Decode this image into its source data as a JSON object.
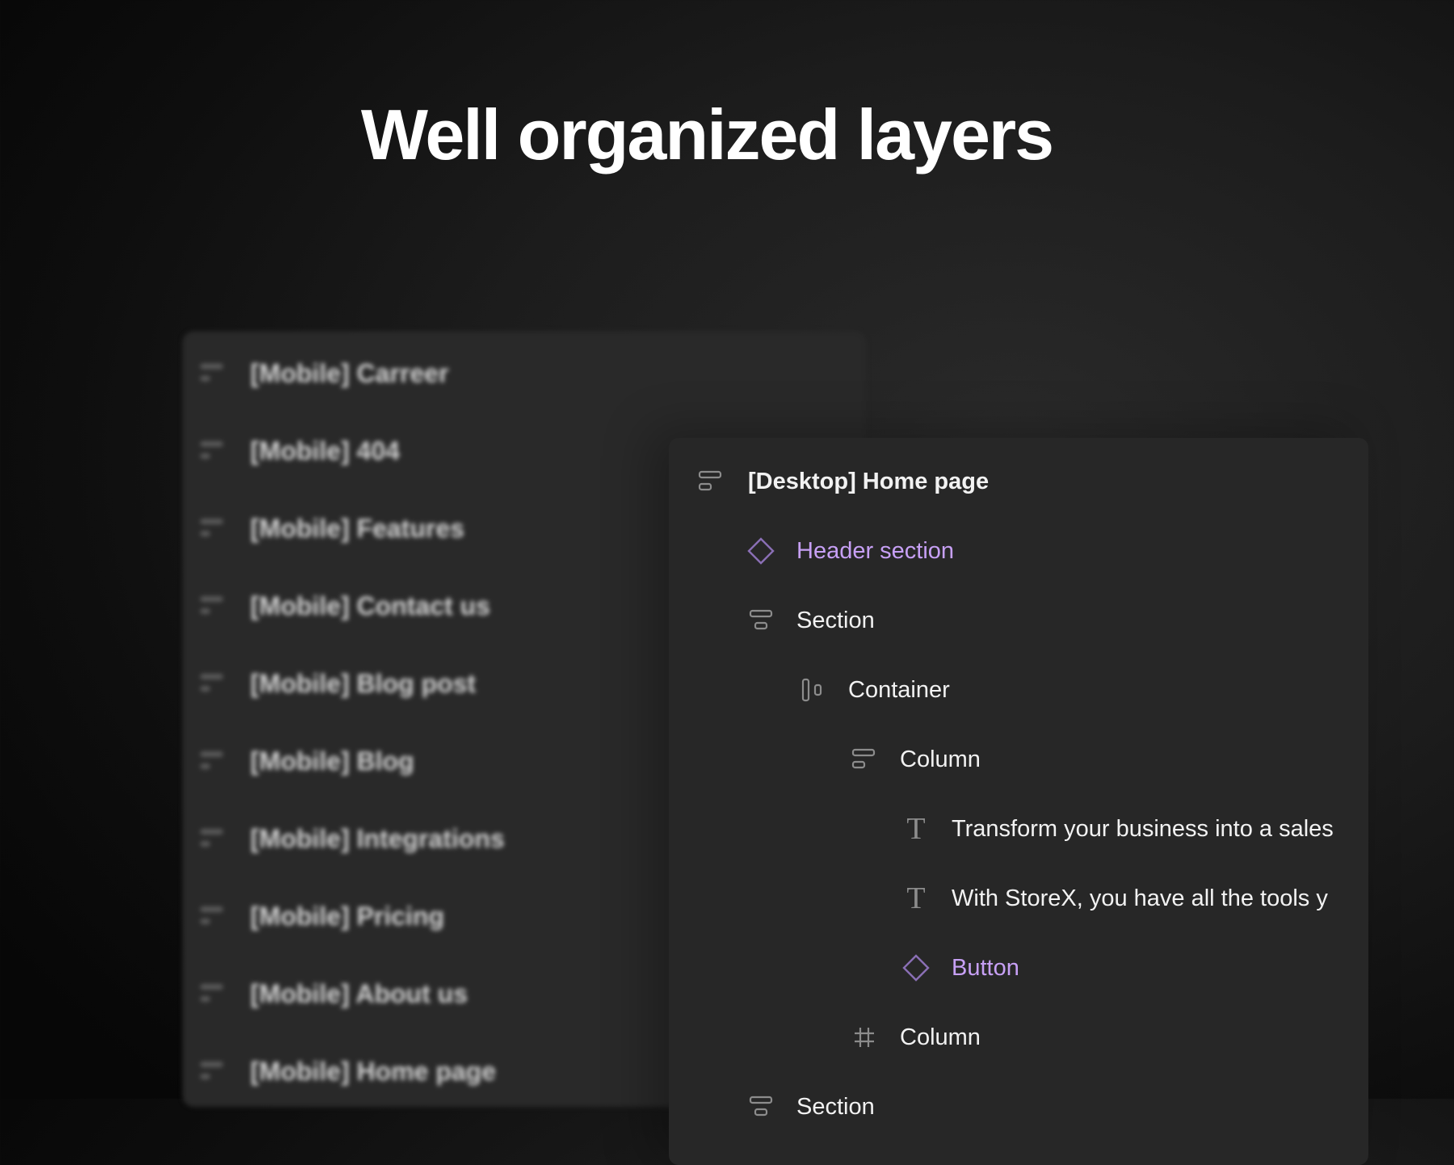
{
  "headline": "Well organized layers",
  "colors": {
    "component": "#c7a0f5",
    "text": "#f2f2f2",
    "icon": "#8c8c8c",
    "panel": "#272727"
  },
  "back_panel": {
    "items": [
      {
        "label": "[Mobile] Carreer",
        "icon": "frame-stack-icon"
      },
      {
        "label": "[Mobile] 404",
        "icon": "frame-stack-icon"
      },
      {
        "label": "[Mobile] Features",
        "icon": "frame-stack-icon"
      },
      {
        "label": "[Mobile] Contact us",
        "icon": "frame-stack-icon"
      },
      {
        "label": "[Mobile] Blog post",
        "icon": "frame-stack-icon"
      },
      {
        "label": "[Mobile] Blog",
        "icon": "frame-stack-icon"
      },
      {
        "label": "[Mobile] Integrations",
        "icon": "frame-stack-icon"
      },
      {
        "label": "[Mobile] Pricing",
        "icon": "frame-stack-icon"
      },
      {
        "label": "[Mobile] About us",
        "icon": "frame-stack-icon"
      },
      {
        "label": "[Mobile] Home page",
        "icon": "frame-stack-icon"
      }
    ]
  },
  "layers_panel": {
    "items": [
      {
        "label": "[Desktop] Home page",
        "icon": "frame-stack-icon",
        "kind": "frame"
      },
      {
        "label": "Header section",
        "icon": "component-diamond-icon",
        "kind": "component"
      },
      {
        "label": "Section",
        "icon": "vertical-stack-icon",
        "kind": "frame"
      },
      {
        "label": "Container",
        "icon": "horizontal-stack-icon",
        "kind": "frame"
      },
      {
        "label": "Column",
        "icon": "frame-stack-icon",
        "kind": "frame"
      },
      {
        "label": "Transform your business into a sales",
        "icon": "text-icon",
        "kind": "text"
      },
      {
        "label": "With StoreX, you have all the tools y",
        "icon": "text-icon",
        "kind": "text"
      },
      {
        "label": "Button",
        "icon": "component-diamond-icon",
        "kind": "component"
      },
      {
        "label": "Column",
        "icon": "grid-frame-icon",
        "kind": "frame"
      },
      {
        "label": "Section",
        "icon": "vertical-stack-icon",
        "kind": "frame"
      }
    ]
  }
}
